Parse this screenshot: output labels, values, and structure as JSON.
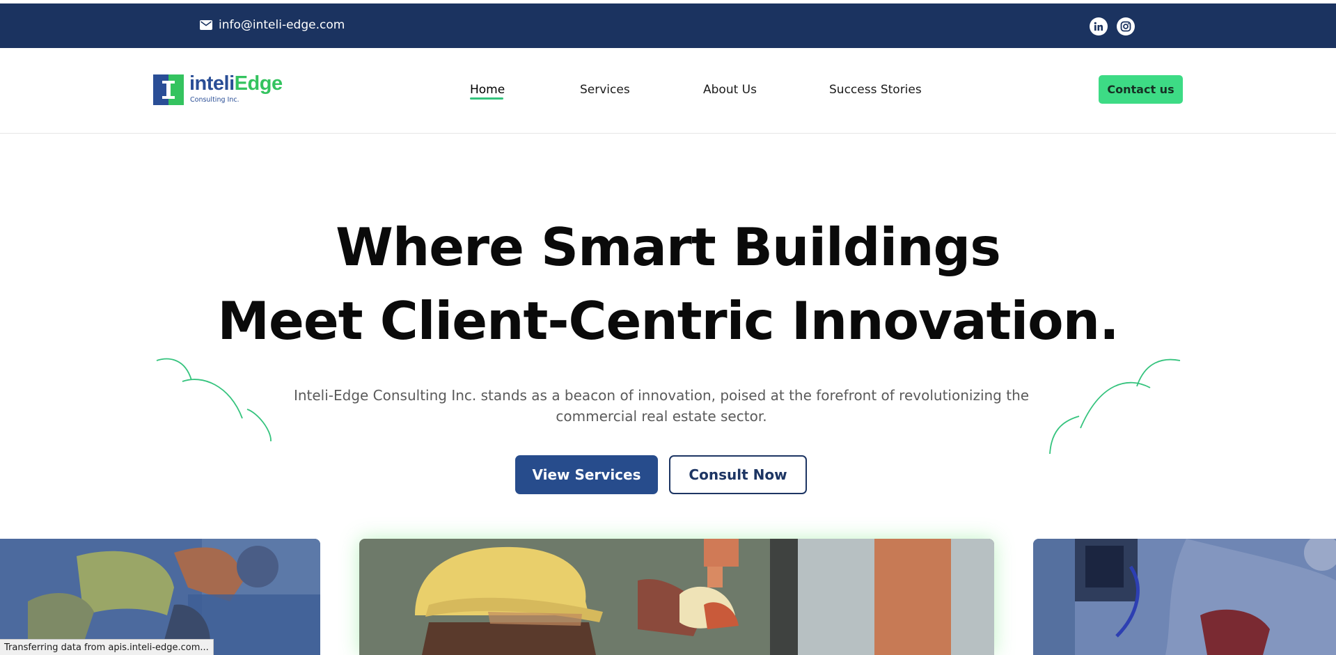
{
  "topbar": {
    "email": "info@inteli-edge.com",
    "email_icon": "mail-icon",
    "social": [
      "linkedin-icon",
      "instagram-icon"
    ]
  },
  "logo": {
    "word_part1": "inteli",
    "word_part2": "Edge",
    "tagline": "Consulting Inc."
  },
  "nav": {
    "items": [
      {
        "label": "Home",
        "active": true
      },
      {
        "label": "Services",
        "active": false
      },
      {
        "label": "About Us",
        "active": false
      },
      {
        "label": "Success Stories",
        "active": false
      }
    ],
    "cta_label": "Contact us"
  },
  "hero": {
    "title_line1": "Where Smart Buildings",
    "title_line2": "Meet Client-Centric Innovation.",
    "subtitle": "Inteli-Edge Consulting Inc. stands as a beacon of innovation, poised at the forefront of revolutionizing the commercial real estate sector.",
    "primary_button": "View Services",
    "secondary_button": "Consult Now"
  },
  "gallery": {
    "images": [
      "construction-workers-photo",
      "electrician-hardhat-photo",
      "ev-charger-photo"
    ]
  },
  "status_bar": "Transferring data from apis.inteli-edge.com...",
  "colors": {
    "topbar": "#1b3360",
    "brand_blue": "#2a4e96",
    "brand_green": "#34c35f",
    "cta_green": "#3ddb85",
    "primary_button": "#274c8c",
    "deco_line": "#34c37d"
  }
}
